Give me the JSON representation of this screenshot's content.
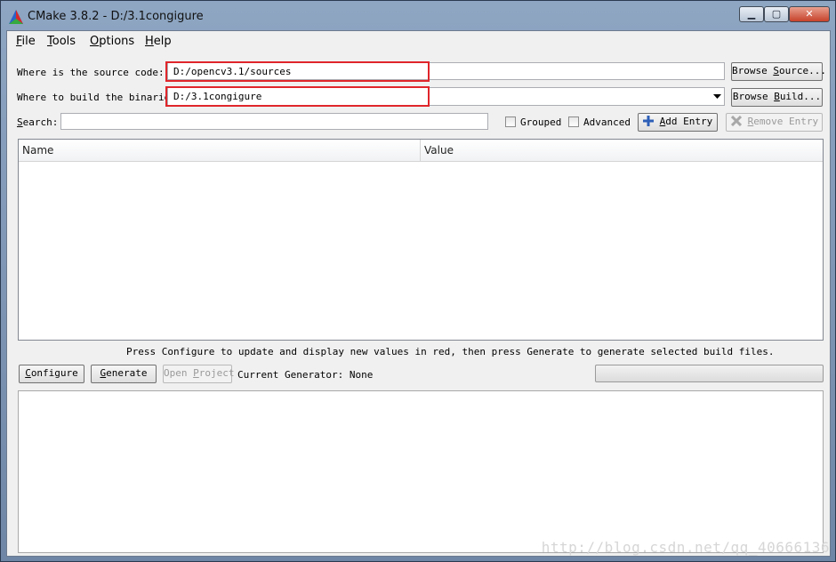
{
  "window": {
    "title": "CMake 3.8.2 - D:/3.1congigure",
    "minimize": "▁",
    "maximize": "▢",
    "close": "✕"
  },
  "menu": [
    {
      "mnemonic": "F",
      "rest": "ile"
    },
    {
      "mnemonic": "T",
      "rest": "ools"
    },
    {
      "mnemonic": "O",
      "rest": "ptions"
    },
    {
      "mnemonic": "H",
      "rest": "elp"
    }
  ],
  "source": {
    "label": "Where is the source code:",
    "value": "D:/opencv3.1/sources",
    "browse_pre": "Browse ",
    "browse_mn": "S",
    "browse_post": "ource..."
  },
  "build": {
    "label": "Where to build the binaries:",
    "value": "D:/3.1congigure",
    "browse_pre": "Browse ",
    "browse_mn": "B",
    "browse_post": "uild..."
  },
  "search": {
    "label_mn": "S",
    "label_rest": "earch:",
    "value": ""
  },
  "options": {
    "grouped": "Grouped",
    "advanced": "Advanced",
    "add_entry_mn": "A",
    "add_entry_rest": "dd Entry",
    "remove_entry_mn": "R",
    "remove_entry_rest": "emove Entry"
  },
  "table": {
    "headers": [
      "Name",
      "Value"
    ]
  },
  "hint": "Press Configure to update and display new values in red, then press Generate to generate selected build files.",
  "actions": {
    "configure_mn": "C",
    "configure_rest": "onfigure",
    "generate_mn": "G",
    "generate_rest": "enerate",
    "open_project_pre": "Open ",
    "open_project_mn": "P",
    "open_project_post": "roject",
    "current_generator": "Current Generator: None"
  },
  "progress": 0,
  "watermark": "http://blog.csdn.net/qq_40666136",
  "colors": {
    "highlight_box": "#e0262b"
  }
}
